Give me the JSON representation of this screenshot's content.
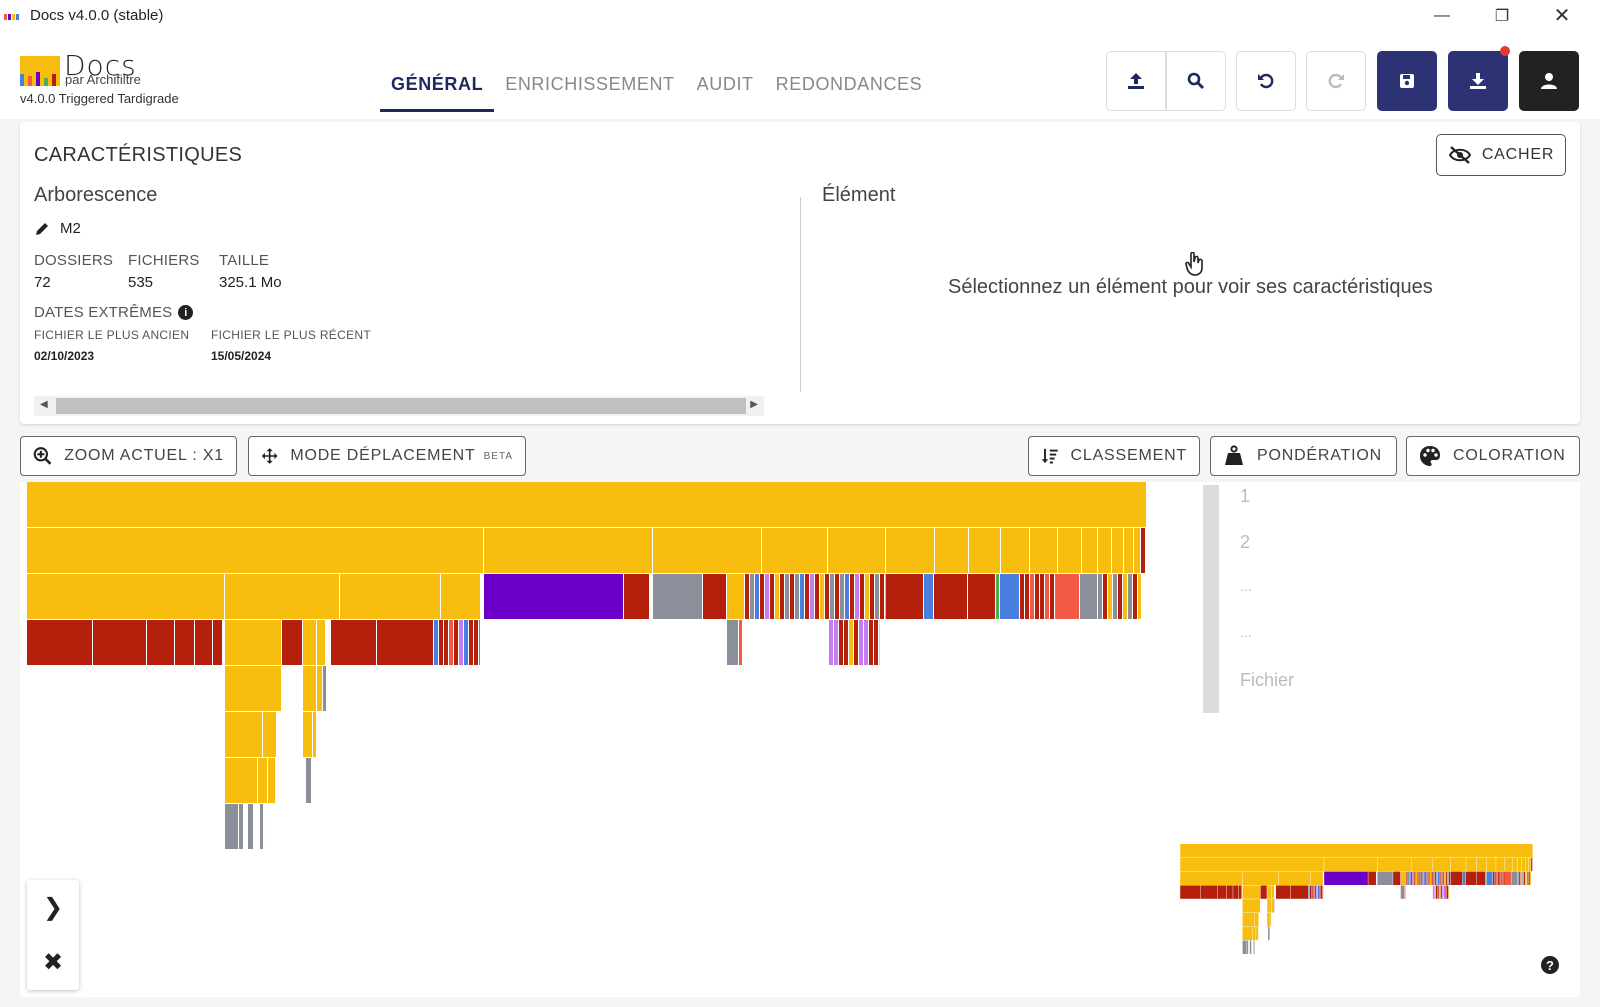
{
  "window": {
    "title": "Docs v4.0.0 (stable)"
  },
  "logo": {
    "name": "Docs",
    "subtitle": "par Archifiltre",
    "version": "v4.0.0 Triggered Tardigrade"
  },
  "tabs": [
    {
      "label": "GÉNÉRAL",
      "active": true
    },
    {
      "label": "ENRICHISSEMENT",
      "active": false
    },
    {
      "label": "AUDIT",
      "active": false
    },
    {
      "label": "REDONDANCES",
      "active": false
    }
  ],
  "toolbar_icons": [
    "upload-icon",
    "search-icon",
    "undo-icon",
    "redo-icon",
    "save-icon",
    "download-icon",
    "user-icon"
  ],
  "panel": {
    "title": "CARACTÉRISTIQUES",
    "hide_label": "CACHER",
    "tree": {
      "title": "Arborescence",
      "name": "M2",
      "folders_label": "DOSSIERS",
      "folders_value": "72",
      "files_label": "FICHIERS",
      "files_value": "535",
      "size_label": "TAILLE",
      "size_value": "325.1 Mo",
      "dates_label": "DATES EXTRÊMES",
      "oldest_label": "FICHIER LE PLUS ANCIEN",
      "oldest_value": "02/10/2023",
      "newest_label": "FICHIER LE PLUS RÉCENT",
      "newest_value": "15/05/2024"
    },
    "element": {
      "title": "Élément",
      "empty_message": "Sélectionnez un élément pour voir ses caractéristiques"
    }
  },
  "controls": {
    "zoom": "ZOOM ACTUEL : X1",
    "move_mode": "MODE DÉPLACEMENT",
    "beta": "BETA",
    "sort": "CLASSEMENT",
    "weight": "PONDÉRATION",
    "color": "COLORATION"
  },
  "levels": [
    "1",
    "2",
    "...",
    "...",
    "Fichier"
  ],
  "colors": {
    "folder": "#f8be0f",
    "red": "#b5200d",
    "purple": "#6a00c8",
    "grey": "#8a8f99",
    "blue": "#4a7fe0",
    "coral": "#f25a45",
    "lilac": "#c47cf0",
    "green": "#4cae4c",
    "primary": "#2c3274"
  }
}
